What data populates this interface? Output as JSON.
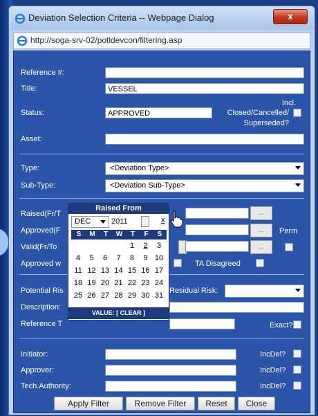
{
  "window": {
    "title": "Deviation Selection Criteria -- Webpage Dialog",
    "close_label": "x",
    "url": "http://soga-srv-02/potldevcon/filtering.asp"
  },
  "form": {
    "reference": {
      "label": "Reference #:",
      "value": ""
    },
    "title": {
      "label": "Title:",
      "value": "VESSEL"
    },
    "status": {
      "label": "Status:",
      "value": "APPROVED"
    },
    "incl_closed": {
      "label_line1": "Incl.",
      "label_line2": "Closed/Cancelled/",
      "label_line3": "Superseded?",
      "checked": false
    },
    "asset": {
      "label": "Asset:",
      "value": ""
    },
    "type": {
      "label": "Type:",
      "value": "<Deviation Type>"
    },
    "subtype": {
      "label": "Sub-Type:",
      "value": "<Deviation Sub-Type>"
    },
    "raised": {
      "label": "Raised(Fr/T",
      "from": "",
      "to": "",
      "button": "..."
    },
    "approved": {
      "label": "Approved(F",
      "to": "",
      "button": "...",
      "perm_label": "Perm"
    },
    "valid": {
      "label": "Valid(Fr/To",
      "to": "",
      "button": "...",
      "perm_checked": false
    },
    "approved_w": {
      "label": "Approved w",
      "ta_disagreed_label": "TA Disagreed"
    },
    "potential_risk": {
      "label": "Potential Ris"
    },
    "residual_risk": {
      "label": "Residual Risk:",
      "value": ""
    },
    "description": {
      "label": "Description:",
      "value": ""
    },
    "reference_t": {
      "label": "Reference T",
      "value": "",
      "exact_label": "Exact?"
    },
    "initiator": {
      "label": "Initiator:",
      "value": "",
      "incdel_label": "IncDel?"
    },
    "approver": {
      "label": "Approver:",
      "value": "",
      "incdel_label": "IncDel?"
    },
    "tech_authority": {
      "label": "Tech.Authority:",
      "value": "",
      "incdel_label": "IncDel?"
    }
  },
  "buttons": {
    "apply": "Apply Filter",
    "remove": "Remove Filter",
    "reset": "Reset",
    "close": "Close"
  },
  "calendar": {
    "title": "Raised From",
    "month": "DEC",
    "year": "2011",
    "close_x": "x",
    "dow": [
      "S",
      "M",
      "T",
      "W",
      "T",
      "F",
      "S"
    ],
    "weeks": [
      [
        "",
        "",
        "",
        "",
        "1",
        "2",
        "3"
      ],
      [
        "4",
        "5",
        "6",
        "7",
        "8",
        "9",
        "10"
      ],
      [
        "11",
        "12",
        "13",
        "14",
        "15",
        "16",
        "17"
      ],
      [
        "18",
        "19",
        "20",
        "21",
        "22",
        "23",
        "24"
      ],
      [
        "25",
        "26",
        "27",
        "28",
        "29",
        "30",
        "31"
      ]
    ],
    "footer_value": "VALUE:",
    "footer_clear": "[ CLEAR ]"
  },
  "icons": [
    "ie-icon",
    "close-icon",
    "calendar-cursor-icon"
  ],
  "colors": {
    "panel": "#2a55a8",
    "calendar_header": "#1d3a7c",
    "close_button": "#c5381c"
  }
}
